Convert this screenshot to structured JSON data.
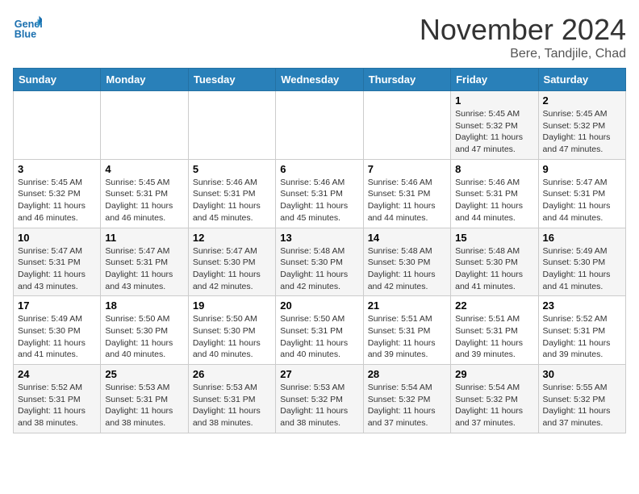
{
  "header": {
    "logo_line1": "General",
    "logo_line2": "Blue",
    "month": "November 2024",
    "location": "Bere, Tandjile, Chad"
  },
  "weekdays": [
    "Sunday",
    "Monday",
    "Tuesday",
    "Wednesday",
    "Thursday",
    "Friday",
    "Saturday"
  ],
  "weeks": [
    [
      {
        "day": "",
        "sunrise": "",
        "sunset": "",
        "daylight": ""
      },
      {
        "day": "",
        "sunrise": "",
        "sunset": "",
        "daylight": ""
      },
      {
        "day": "",
        "sunrise": "",
        "sunset": "",
        "daylight": ""
      },
      {
        "day": "",
        "sunrise": "",
        "sunset": "",
        "daylight": ""
      },
      {
        "day": "",
        "sunrise": "",
        "sunset": "",
        "daylight": ""
      },
      {
        "day": "1",
        "sunrise": "Sunrise: 5:45 AM",
        "sunset": "Sunset: 5:32 PM",
        "daylight": "Daylight: 11 hours and 47 minutes."
      },
      {
        "day": "2",
        "sunrise": "Sunrise: 5:45 AM",
        "sunset": "Sunset: 5:32 PM",
        "daylight": "Daylight: 11 hours and 47 minutes."
      }
    ],
    [
      {
        "day": "3",
        "sunrise": "Sunrise: 5:45 AM",
        "sunset": "Sunset: 5:32 PM",
        "daylight": "Daylight: 11 hours and 46 minutes."
      },
      {
        "day": "4",
        "sunrise": "Sunrise: 5:45 AM",
        "sunset": "Sunset: 5:31 PM",
        "daylight": "Daylight: 11 hours and 46 minutes."
      },
      {
        "day": "5",
        "sunrise": "Sunrise: 5:46 AM",
        "sunset": "Sunset: 5:31 PM",
        "daylight": "Daylight: 11 hours and 45 minutes."
      },
      {
        "day": "6",
        "sunrise": "Sunrise: 5:46 AM",
        "sunset": "Sunset: 5:31 PM",
        "daylight": "Daylight: 11 hours and 45 minutes."
      },
      {
        "day": "7",
        "sunrise": "Sunrise: 5:46 AM",
        "sunset": "Sunset: 5:31 PM",
        "daylight": "Daylight: 11 hours and 44 minutes."
      },
      {
        "day": "8",
        "sunrise": "Sunrise: 5:46 AM",
        "sunset": "Sunset: 5:31 PM",
        "daylight": "Daylight: 11 hours and 44 minutes."
      },
      {
        "day": "9",
        "sunrise": "Sunrise: 5:47 AM",
        "sunset": "Sunset: 5:31 PM",
        "daylight": "Daylight: 11 hours and 44 minutes."
      }
    ],
    [
      {
        "day": "10",
        "sunrise": "Sunrise: 5:47 AM",
        "sunset": "Sunset: 5:31 PM",
        "daylight": "Daylight: 11 hours and 43 minutes."
      },
      {
        "day": "11",
        "sunrise": "Sunrise: 5:47 AM",
        "sunset": "Sunset: 5:31 PM",
        "daylight": "Daylight: 11 hours and 43 minutes."
      },
      {
        "day": "12",
        "sunrise": "Sunrise: 5:47 AM",
        "sunset": "Sunset: 5:30 PM",
        "daylight": "Daylight: 11 hours and 42 minutes."
      },
      {
        "day": "13",
        "sunrise": "Sunrise: 5:48 AM",
        "sunset": "Sunset: 5:30 PM",
        "daylight": "Daylight: 11 hours and 42 minutes."
      },
      {
        "day": "14",
        "sunrise": "Sunrise: 5:48 AM",
        "sunset": "Sunset: 5:30 PM",
        "daylight": "Daylight: 11 hours and 42 minutes."
      },
      {
        "day": "15",
        "sunrise": "Sunrise: 5:48 AM",
        "sunset": "Sunset: 5:30 PM",
        "daylight": "Daylight: 11 hours and 41 minutes."
      },
      {
        "day": "16",
        "sunrise": "Sunrise: 5:49 AM",
        "sunset": "Sunset: 5:30 PM",
        "daylight": "Daylight: 11 hours and 41 minutes."
      }
    ],
    [
      {
        "day": "17",
        "sunrise": "Sunrise: 5:49 AM",
        "sunset": "Sunset: 5:30 PM",
        "daylight": "Daylight: 11 hours and 41 minutes."
      },
      {
        "day": "18",
        "sunrise": "Sunrise: 5:50 AM",
        "sunset": "Sunset: 5:30 PM",
        "daylight": "Daylight: 11 hours and 40 minutes."
      },
      {
        "day": "19",
        "sunrise": "Sunrise: 5:50 AM",
        "sunset": "Sunset: 5:30 PM",
        "daylight": "Daylight: 11 hours and 40 minutes."
      },
      {
        "day": "20",
        "sunrise": "Sunrise: 5:50 AM",
        "sunset": "Sunset: 5:31 PM",
        "daylight": "Daylight: 11 hours and 40 minutes."
      },
      {
        "day": "21",
        "sunrise": "Sunrise: 5:51 AM",
        "sunset": "Sunset: 5:31 PM",
        "daylight": "Daylight: 11 hours and 39 minutes."
      },
      {
        "day": "22",
        "sunrise": "Sunrise: 5:51 AM",
        "sunset": "Sunset: 5:31 PM",
        "daylight": "Daylight: 11 hours and 39 minutes."
      },
      {
        "day": "23",
        "sunrise": "Sunrise: 5:52 AM",
        "sunset": "Sunset: 5:31 PM",
        "daylight": "Daylight: 11 hours and 39 minutes."
      }
    ],
    [
      {
        "day": "24",
        "sunrise": "Sunrise: 5:52 AM",
        "sunset": "Sunset: 5:31 PM",
        "daylight": "Daylight: 11 hours and 38 minutes."
      },
      {
        "day": "25",
        "sunrise": "Sunrise: 5:53 AM",
        "sunset": "Sunset: 5:31 PM",
        "daylight": "Daylight: 11 hours and 38 minutes."
      },
      {
        "day": "26",
        "sunrise": "Sunrise: 5:53 AM",
        "sunset": "Sunset: 5:31 PM",
        "daylight": "Daylight: 11 hours and 38 minutes."
      },
      {
        "day": "27",
        "sunrise": "Sunrise: 5:53 AM",
        "sunset": "Sunset: 5:32 PM",
        "daylight": "Daylight: 11 hours and 38 minutes."
      },
      {
        "day": "28",
        "sunrise": "Sunrise: 5:54 AM",
        "sunset": "Sunset: 5:32 PM",
        "daylight": "Daylight: 11 hours and 37 minutes."
      },
      {
        "day": "29",
        "sunrise": "Sunrise: 5:54 AM",
        "sunset": "Sunset: 5:32 PM",
        "daylight": "Daylight: 11 hours and 37 minutes."
      },
      {
        "day": "30",
        "sunrise": "Sunrise: 5:55 AM",
        "sunset": "Sunset: 5:32 PM",
        "daylight": "Daylight: 11 hours and 37 minutes."
      }
    ]
  ]
}
